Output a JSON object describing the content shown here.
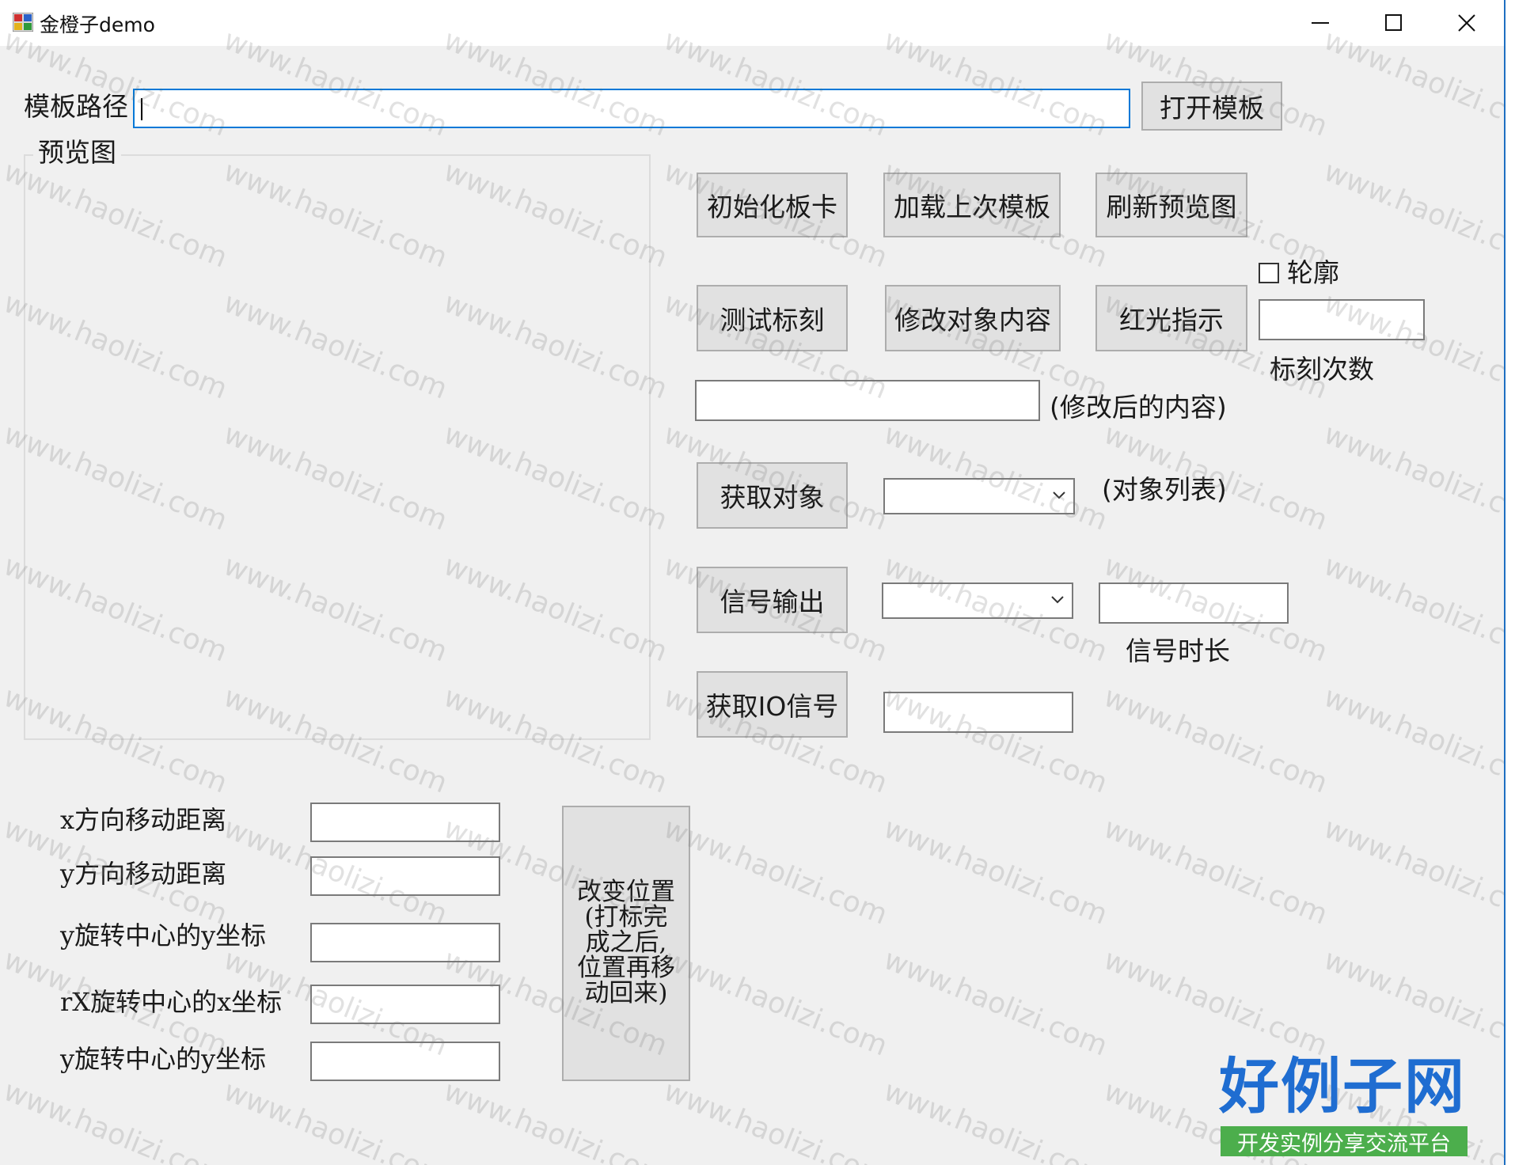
{
  "window": {
    "title": "金橙子demo",
    "minimize_icon": "minimize-icon",
    "maximize_icon": "maximize-icon",
    "close_icon": "close-icon"
  },
  "template": {
    "label": "模板路径",
    "path_value": "",
    "open_button": "打开模板"
  },
  "preview": {
    "title": "预览图"
  },
  "buttons": {
    "init_card": "初始化板卡",
    "load_last_template": "加载上次模板",
    "refresh_preview": "刷新预览图",
    "test_mark": "测试标刻",
    "modify_object_content": "修改对象内容",
    "red_light": "红光指示",
    "get_objects": "获取对象",
    "signal_output": "信号输出",
    "get_io_signal": "获取IO信号",
    "change_position": "改变位置\n(打标完\n成之后,\n位置再移\n动回来)"
  },
  "outline": {
    "label": "轮廓",
    "checked": false
  },
  "mark_count": {
    "value": "",
    "label": "标刻次数"
  },
  "modified_content": {
    "value": "",
    "label": "(修改后的内容)"
  },
  "object_list": {
    "selected": "",
    "label": "(对象列表)"
  },
  "signal": {
    "selected": "",
    "duration_value": "",
    "duration_label": "信号时长"
  },
  "io_signal": {
    "value": ""
  },
  "movement": {
    "fields": [
      {
        "label": "x方向移动距离",
        "value": ""
      },
      {
        "label": "y方向移动距离",
        "value": ""
      },
      {
        "label": "y旋转中心的y坐标",
        "value": ""
      },
      {
        "label": "rX旋转中心的x坐标",
        "value": ""
      },
      {
        "label": "y旋转中心的y坐标",
        "value": ""
      }
    ]
  },
  "watermark": {
    "text": "www.haolizi.com"
  },
  "logo": {
    "main": "好例子网",
    "sub": "开发实例分享交流平台"
  },
  "colors": {
    "window_bg": "#f0f0f0",
    "button_bg": "#e1e1e1",
    "focus_border": "#0078d7",
    "logo_blue": "#1f6dd1",
    "logo_green": "#4cae4c"
  }
}
